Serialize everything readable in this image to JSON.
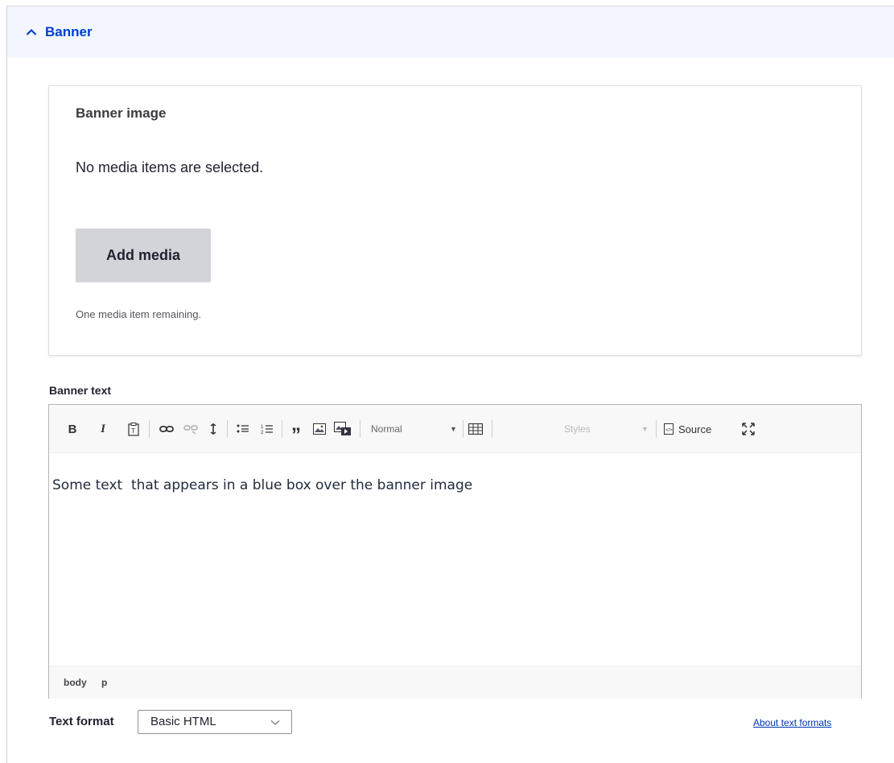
{
  "section": {
    "title": "Banner",
    "expanded_icon": "chevron-up-icon"
  },
  "media": {
    "label": "Banner image",
    "empty_message": "No media items are selected.",
    "add_button": "Add media",
    "remaining": "One media item remaining."
  },
  "editor": {
    "label": "Banner text",
    "toolbar": {
      "bold": "B",
      "italic": "I",
      "paste_text_icon": "paste-text-icon",
      "link_icon": "link-icon",
      "unlink_icon": "unlink-icon",
      "anchor_icon": "anchor-icon",
      "bulleted_list_icon": "bulleted-list-icon",
      "numbered_list_icon": "numbered-list-icon",
      "blockquote": "”",
      "image_icon": "image-icon",
      "media_icon": "media-icon",
      "format_select": "Normal",
      "table_icon": "table-icon",
      "styles_select": "Styles",
      "source_label": "Source",
      "maximize_icon": "maximize-icon"
    },
    "content": "Some text  that appears in a blue box over the banner image",
    "path": [
      "body",
      "p"
    ]
  },
  "text_format": {
    "label": "Text format",
    "selected": "Basic HTML",
    "about_link": "About text formats"
  },
  "colors": {
    "accent": "#003ecc",
    "header_bg": "#f3f6fd",
    "button_bg": "#d3d4d9"
  }
}
